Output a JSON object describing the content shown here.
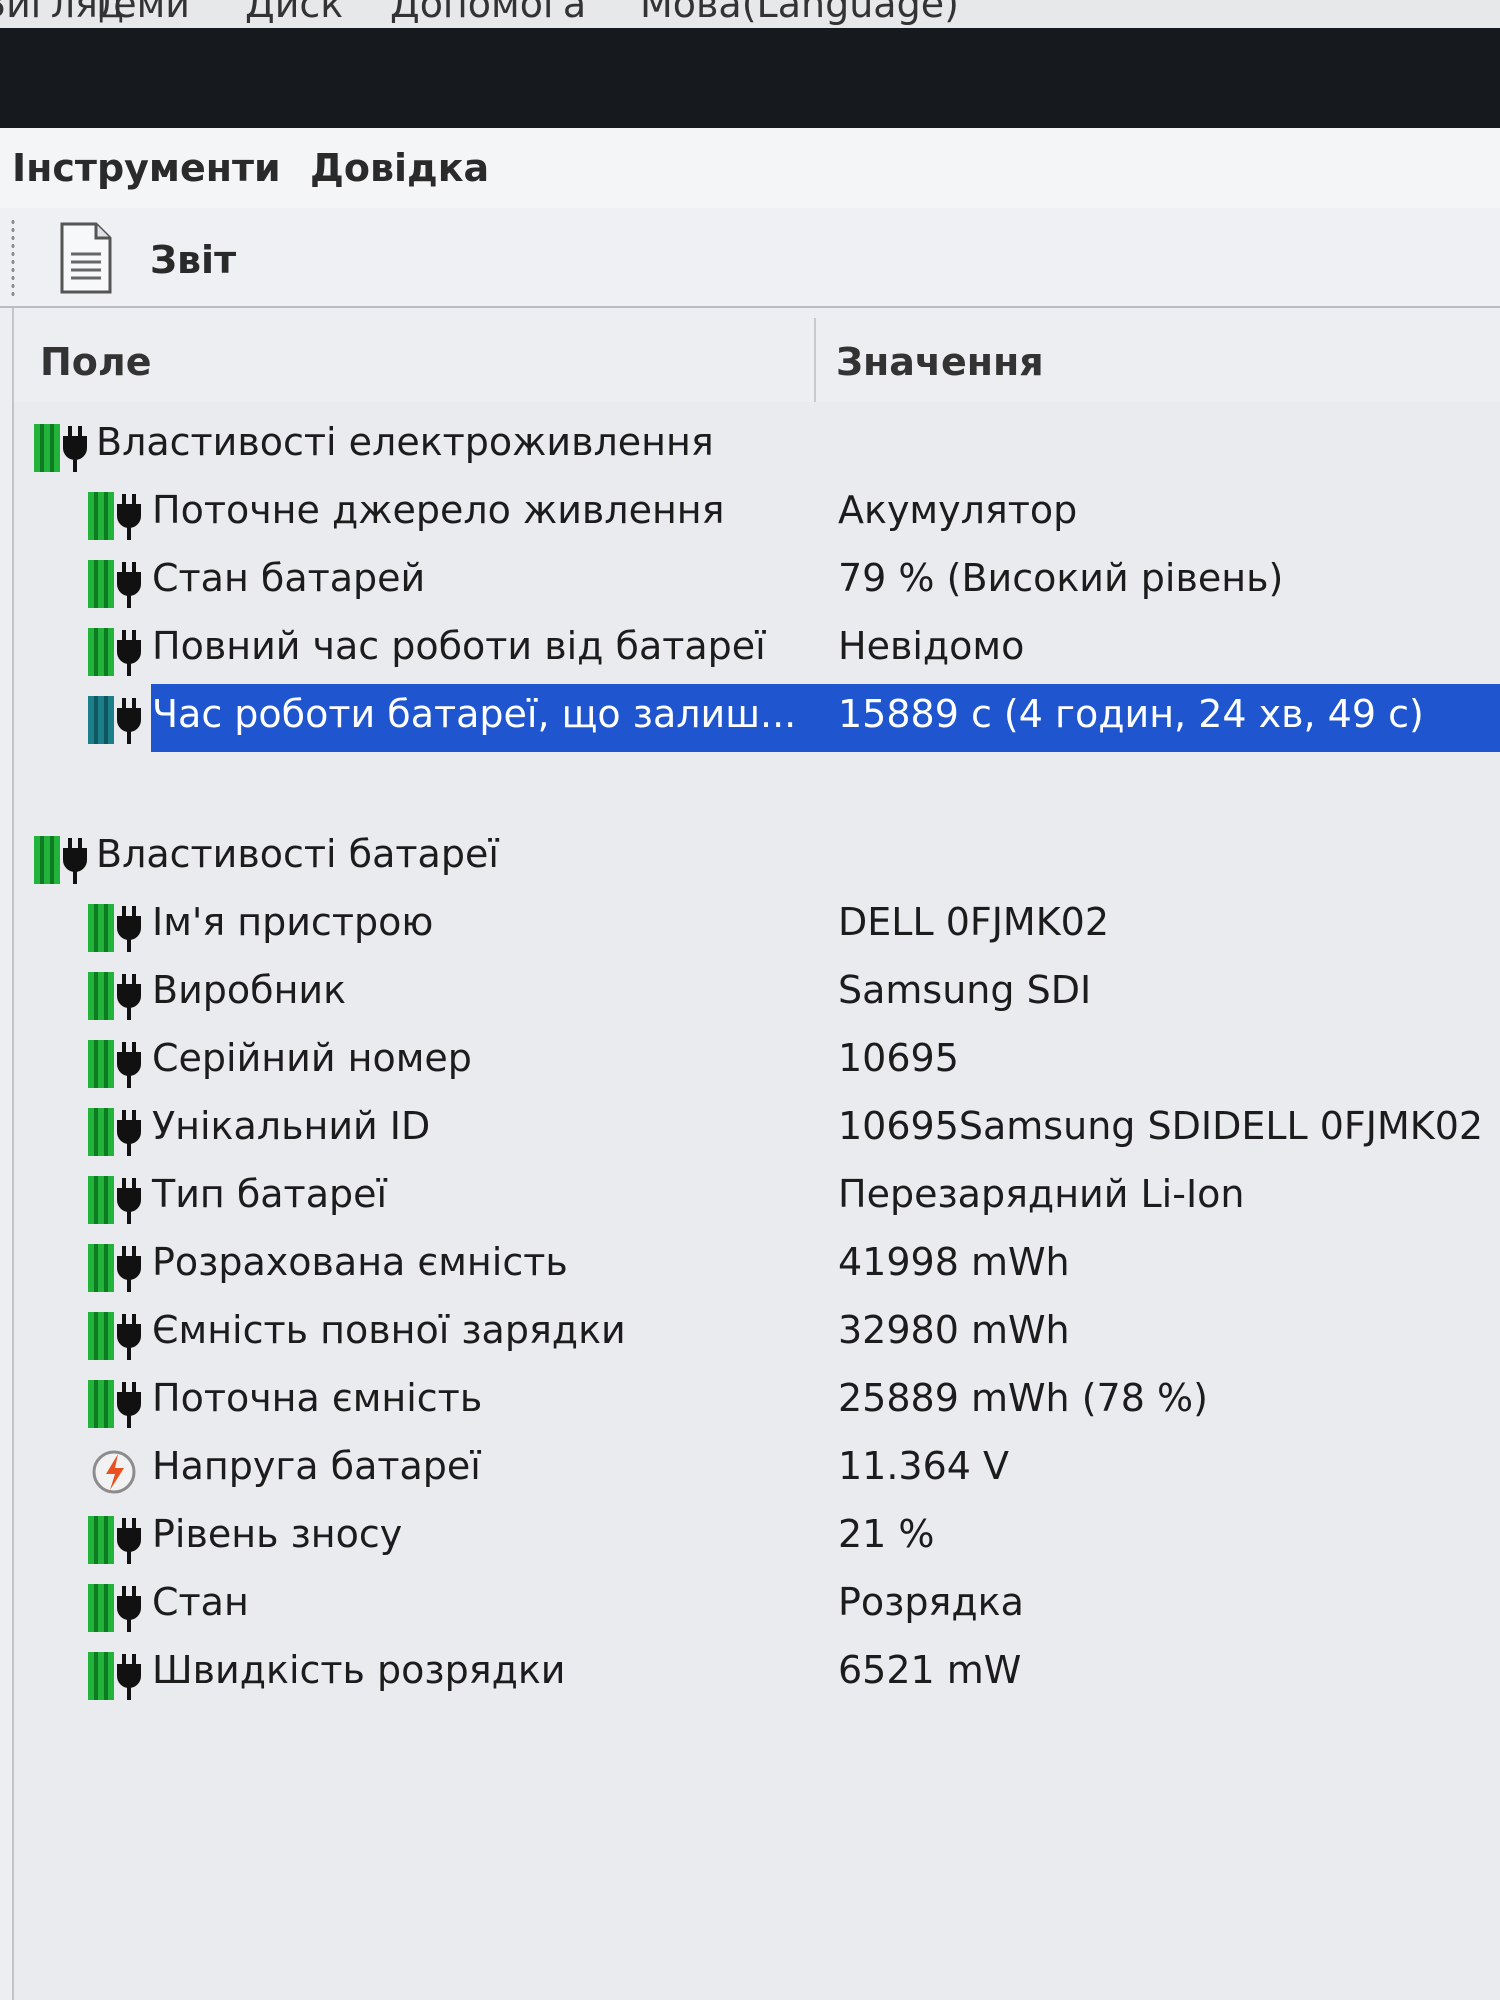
{
  "top_menu": [
    "Вигляд",
    "Теми",
    "Диск",
    "Допомога",
    "Мова(Language)"
  ],
  "menubar": {
    "tools": "Інструменти",
    "help": "Довідка"
  },
  "toolbar": {
    "report_label": "Звіт"
  },
  "columns": {
    "field": "Поле",
    "value": "Значення"
  },
  "groups": [
    {
      "title": "Властивості електроживлення",
      "rows": [
        {
          "field": "Поточне джерело живлення",
          "value": "Акумулятор"
        },
        {
          "field": "Стан батарей",
          "value": "79 % (Високий рівень)"
        },
        {
          "field": "Повний час роботи від батареї",
          "value": "Невідомо"
        },
        {
          "field": "Час роботи батареї, що залиш...",
          "value": "15889 с (4 годин, 24 хв, 49 с)"
        }
      ]
    },
    {
      "title": "Властивості батареї",
      "rows": [
        {
          "field": "Ім'я пристрою",
          "value": "DELL 0FJMK02"
        },
        {
          "field": "Виробник",
          "value": "Samsung SDI"
        },
        {
          "field": "Серійний номер",
          "value": "10695"
        },
        {
          "field": "Унікальний ID",
          "value": "10695Samsung SDIDELL 0FJMK02"
        },
        {
          "field": "Тип батареї",
          "value": "Перезарядний Li-Ion"
        },
        {
          "field": "Розрахована ємність",
          "value": "41998 mWh"
        },
        {
          "field": "Ємність повної зарядки",
          "value": "32980 mWh"
        },
        {
          "field": "Поточна ємність",
          "value": "25889 mWh  (78 %)"
        },
        {
          "field": "Напруга батареї",
          "value": "11.364 V"
        },
        {
          "field": "Рівень зносу",
          "value": "21 %"
        },
        {
          "field": "Стан",
          "value": "Розрядка"
        },
        {
          "field": "Швидкість розрядки",
          "value": "6521 mW"
        }
      ]
    }
  ],
  "icons": {
    "battery_plug": "battery-plug-icon",
    "voltage": "voltage-icon",
    "report": "document-icon"
  },
  "colors": {
    "selection": "#1f56cf",
    "battery_green": "#21b33a"
  }
}
